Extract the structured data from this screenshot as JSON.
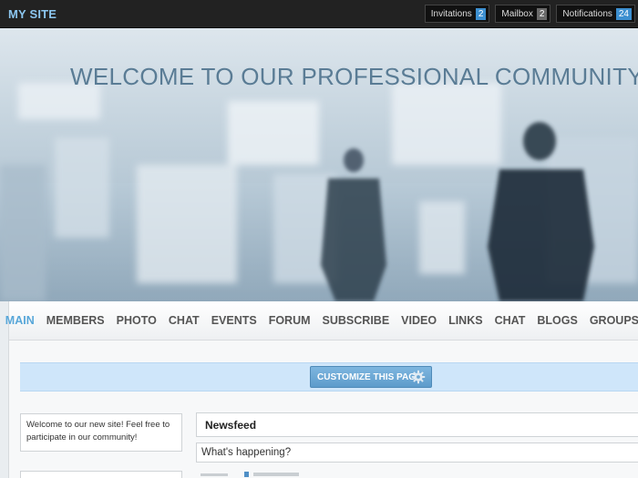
{
  "topbar": {
    "site_name": "MY SITE",
    "buttons": [
      {
        "label": "Invitations",
        "count": "2",
        "highlight": false
      },
      {
        "label": "Mailbox",
        "count": "2",
        "highlight": false
      },
      {
        "label": "Notifications",
        "count": "24",
        "highlight": true
      }
    ]
  },
  "hero": {
    "title": "WELCOME TO OUR PROFESSIONAL COMMUNITY WEBS"
  },
  "nav": {
    "items": [
      "MAIN",
      "MEMBERS",
      "PHOTO",
      "CHAT",
      "EVENTS",
      "FORUM",
      "SUBSCRIBE",
      "VIDEO",
      "LINKS",
      "CHAT",
      "BLOGS",
      "GROUPS"
    ],
    "active": "MAIN"
  },
  "customize": {
    "label": "CUSTOMIZE THIS PAGE"
  },
  "sidebar": {
    "welcome_text": "Welcome to our new site! Feel free to participate in our community!"
  },
  "newsfeed": {
    "title": "Newsfeed",
    "status_placeholder": "What's happening?"
  },
  "colors": {
    "accent": "#58a7d9",
    "topbar_bg": "#222222",
    "badge_blue": "#3c8fd0",
    "customize_bar": "#cfe6fa"
  }
}
